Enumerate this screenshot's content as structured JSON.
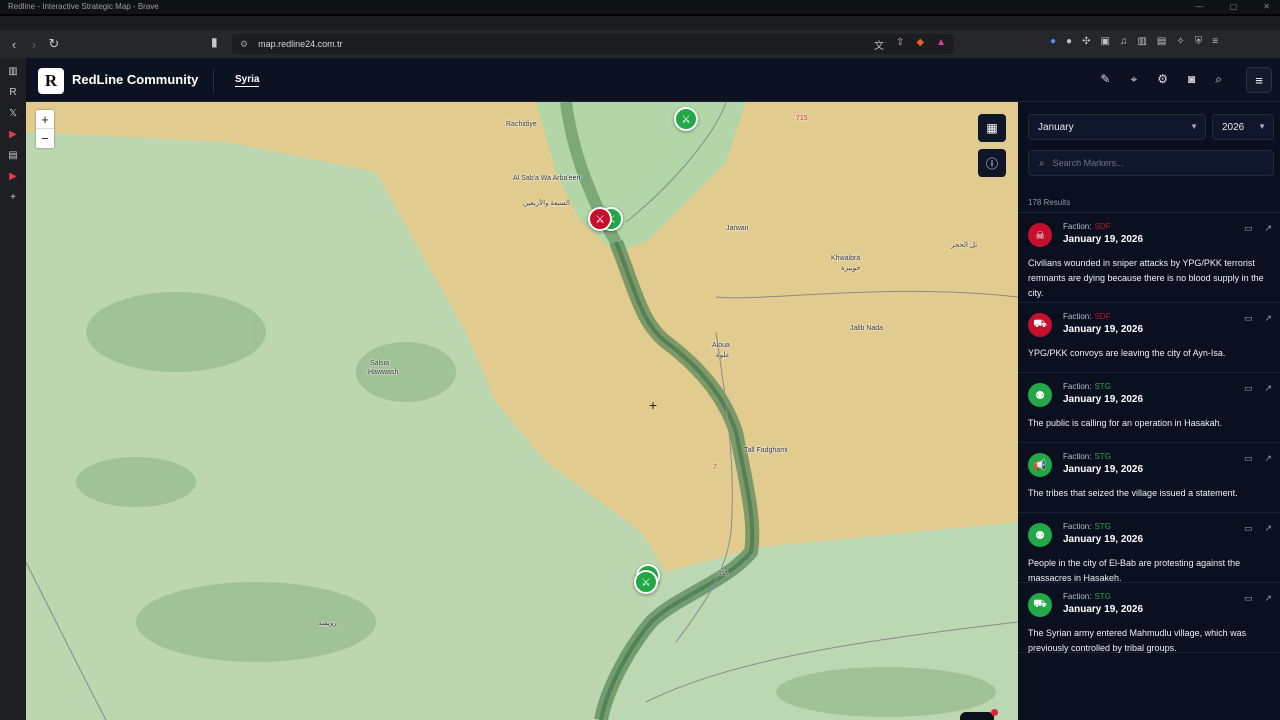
{
  "browser": {
    "window_title": "Redline - Interactive Strategic Map - Brave",
    "url": "map.redline24.com.tr"
  },
  "app": {
    "logo_letter": "R",
    "brand_name": "RedLine Community",
    "region_tab": "Syria",
    "header_tools": [
      "edit-icon",
      "pin-icon",
      "gear-icon",
      "camera-icon",
      "search-icon"
    ],
    "menu_icon": "hamburger-icon"
  },
  "map": {
    "zoom_in": "+",
    "zoom_out": "−",
    "places": {
      "rachidiye": "Rachidiye",
      "al_saba": "Al Sab'a Wa Arba'een",
      "al_saba_ar": "السبعة والأربعين",
      "jarwan": "Jarwan",
      "khwaibra": "Khwaibra",
      "khwaibra_ar": "خويبرة",
      "tel_hajar": "تل الحجر",
      "jalib_nada": "Jalib Nada",
      "aloua": "Aloua",
      "aloua_ar": "علوة",
      "salsia": "Salsia",
      "hawwash": "Hawwash",
      "tall_fadghami": "Tall Fadghami",
      "ina": "Ina",
      "ruwaysa_ar": "رويسة",
      "road_715": "715",
      "road_7": "7"
    },
    "badge_letter": "R"
  },
  "panel": {
    "month": "January",
    "year": "2026",
    "search_placeholder": "Search Markers...",
    "results": "178 Results",
    "items": [
      {
        "faction_label": "Faction:",
        "faction": "SDF",
        "date": "January 19, 2026",
        "text": "Civilians wounded in sniper attacks by YPG/PKK terrorist remnants are dying because there is no blood supply in the city.",
        "icon": "skull-icon",
        "color": "#c4102c"
      },
      {
        "faction_label": "Faction:",
        "faction": "SDF",
        "date": "January 19, 2026",
        "text": "YPG/PKK convoys are leaving the city of Ayn-Isa.",
        "icon": "truck-icon",
        "color": "#c4102c"
      },
      {
        "faction_label": "Faction:",
        "faction": "STG",
        "date": "January 19, 2026",
        "text": "The public is calling for an operation in Hasakah.",
        "icon": "crowd-icon",
        "color": "#22a847"
      },
      {
        "faction_label": "Faction:",
        "faction": "STG",
        "date": "January 19, 2026",
        "text": "The tribes that seized the village issued a statement.",
        "icon": "megaphone-icon",
        "color": "#22a847"
      },
      {
        "faction_label": "Faction:",
        "faction": "STG",
        "date": "January 19, 2026",
        "text": "People in the city of El-Bab are protesting against the massacres in Hasakeh.",
        "icon": "crowd-icon",
        "color": "#22a847"
      },
      {
        "faction_label": "Faction:",
        "faction": "STG",
        "date": "January 19, 2026",
        "text": "The Syrian army entered Mahmudlu village, which was previously controlled by tribal groups.",
        "icon": "truck-icon",
        "color": "#22a847"
      }
    ]
  }
}
